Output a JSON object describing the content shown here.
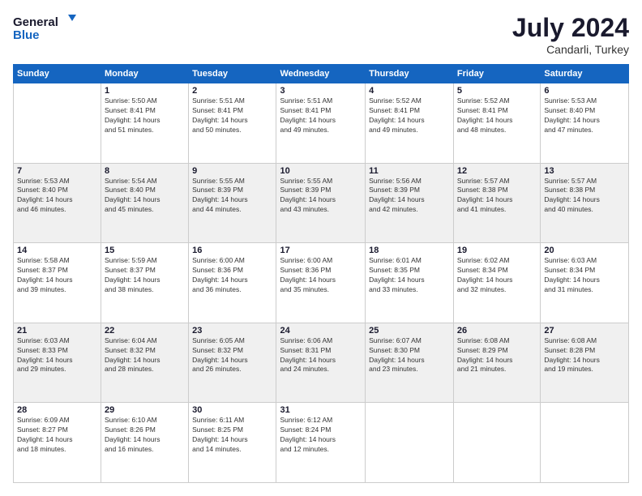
{
  "logo": {
    "line1": "General",
    "line2": "Blue"
  },
  "header": {
    "month_year": "July 2024",
    "location": "Candarli, Turkey"
  },
  "weekdays": [
    "Sunday",
    "Monday",
    "Tuesday",
    "Wednesday",
    "Thursday",
    "Friday",
    "Saturday"
  ],
  "weeks": [
    [
      {
        "day": "",
        "info": ""
      },
      {
        "day": "1",
        "info": "Sunrise: 5:50 AM\nSunset: 8:41 PM\nDaylight: 14 hours\nand 51 minutes."
      },
      {
        "day": "2",
        "info": "Sunrise: 5:51 AM\nSunset: 8:41 PM\nDaylight: 14 hours\nand 50 minutes."
      },
      {
        "day": "3",
        "info": "Sunrise: 5:51 AM\nSunset: 8:41 PM\nDaylight: 14 hours\nand 49 minutes."
      },
      {
        "day": "4",
        "info": "Sunrise: 5:52 AM\nSunset: 8:41 PM\nDaylight: 14 hours\nand 49 minutes."
      },
      {
        "day": "5",
        "info": "Sunrise: 5:52 AM\nSunset: 8:41 PM\nDaylight: 14 hours\nand 48 minutes."
      },
      {
        "day": "6",
        "info": "Sunrise: 5:53 AM\nSunset: 8:40 PM\nDaylight: 14 hours\nand 47 minutes."
      }
    ],
    [
      {
        "day": "7",
        "info": "Sunrise: 5:53 AM\nSunset: 8:40 PM\nDaylight: 14 hours\nand 46 minutes."
      },
      {
        "day": "8",
        "info": "Sunrise: 5:54 AM\nSunset: 8:40 PM\nDaylight: 14 hours\nand 45 minutes."
      },
      {
        "day": "9",
        "info": "Sunrise: 5:55 AM\nSunset: 8:39 PM\nDaylight: 14 hours\nand 44 minutes."
      },
      {
        "day": "10",
        "info": "Sunrise: 5:55 AM\nSunset: 8:39 PM\nDaylight: 14 hours\nand 43 minutes."
      },
      {
        "day": "11",
        "info": "Sunrise: 5:56 AM\nSunset: 8:39 PM\nDaylight: 14 hours\nand 42 minutes."
      },
      {
        "day": "12",
        "info": "Sunrise: 5:57 AM\nSunset: 8:38 PM\nDaylight: 14 hours\nand 41 minutes."
      },
      {
        "day": "13",
        "info": "Sunrise: 5:57 AM\nSunset: 8:38 PM\nDaylight: 14 hours\nand 40 minutes."
      }
    ],
    [
      {
        "day": "14",
        "info": "Sunrise: 5:58 AM\nSunset: 8:37 PM\nDaylight: 14 hours\nand 39 minutes."
      },
      {
        "day": "15",
        "info": "Sunrise: 5:59 AM\nSunset: 8:37 PM\nDaylight: 14 hours\nand 38 minutes."
      },
      {
        "day": "16",
        "info": "Sunrise: 6:00 AM\nSunset: 8:36 PM\nDaylight: 14 hours\nand 36 minutes."
      },
      {
        "day": "17",
        "info": "Sunrise: 6:00 AM\nSunset: 8:36 PM\nDaylight: 14 hours\nand 35 minutes."
      },
      {
        "day": "18",
        "info": "Sunrise: 6:01 AM\nSunset: 8:35 PM\nDaylight: 14 hours\nand 33 minutes."
      },
      {
        "day": "19",
        "info": "Sunrise: 6:02 AM\nSunset: 8:34 PM\nDaylight: 14 hours\nand 32 minutes."
      },
      {
        "day": "20",
        "info": "Sunrise: 6:03 AM\nSunset: 8:34 PM\nDaylight: 14 hours\nand 31 minutes."
      }
    ],
    [
      {
        "day": "21",
        "info": "Sunrise: 6:03 AM\nSunset: 8:33 PM\nDaylight: 14 hours\nand 29 minutes."
      },
      {
        "day": "22",
        "info": "Sunrise: 6:04 AM\nSunset: 8:32 PM\nDaylight: 14 hours\nand 28 minutes."
      },
      {
        "day": "23",
        "info": "Sunrise: 6:05 AM\nSunset: 8:32 PM\nDaylight: 14 hours\nand 26 minutes."
      },
      {
        "day": "24",
        "info": "Sunrise: 6:06 AM\nSunset: 8:31 PM\nDaylight: 14 hours\nand 24 minutes."
      },
      {
        "day": "25",
        "info": "Sunrise: 6:07 AM\nSunset: 8:30 PM\nDaylight: 14 hours\nand 23 minutes."
      },
      {
        "day": "26",
        "info": "Sunrise: 6:08 AM\nSunset: 8:29 PM\nDaylight: 14 hours\nand 21 minutes."
      },
      {
        "day": "27",
        "info": "Sunrise: 6:08 AM\nSunset: 8:28 PM\nDaylight: 14 hours\nand 19 minutes."
      }
    ],
    [
      {
        "day": "28",
        "info": "Sunrise: 6:09 AM\nSunset: 8:27 PM\nDaylight: 14 hours\nand 18 minutes."
      },
      {
        "day": "29",
        "info": "Sunrise: 6:10 AM\nSunset: 8:26 PM\nDaylight: 14 hours\nand 16 minutes."
      },
      {
        "day": "30",
        "info": "Sunrise: 6:11 AM\nSunset: 8:25 PM\nDaylight: 14 hours\nand 14 minutes."
      },
      {
        "day": "31",
        "info": "Sunrise: 6:12 AM\nSunset: 8:24 PM\nDaylight: 14 hours\nand 12 minutes."
      },
      {
        "day": "",
        "info": ""
      },
      {
        "day": "",
        "info": ""
      },
      {
        "day": "",
        "info": ""
      }
    ]
  ]
}
